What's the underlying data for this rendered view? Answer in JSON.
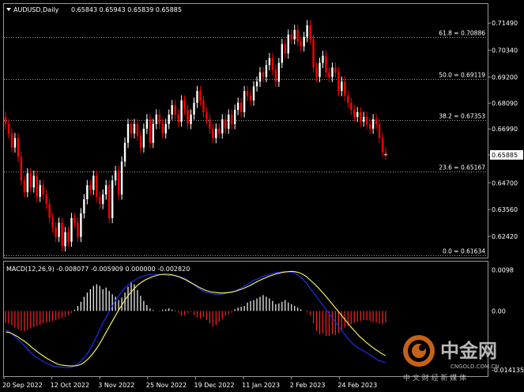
{
  "header": {
    "symbol": "AUDUSD,Daily",
    "ohlc": "0.65843 0.65943 0.65839 0.65885",
    "macd_label": "MACD(12,26,9) -0.008077 -0.005909 0.000000 -0.002820"
  },
  "colors": {
    "background": "#000000",
    "bull_candle": "#ffffff",
    "bear_candle": "#ff0000",
    "grid": "#9a9a9a",
    "macd_main": "#2030ff",
    "macd_signal": "#ffff66",
    "hist_pos": "#ffffff",
    "hist_neg": "#ff2020"
  },
  "chart_data": [
    {
      "type": "candlestick",
      "title": "AUDUSD,Daily",
      "price_axis_ticks": [
        "0.71490",
        "0.70340",
        "0.69200",
        "0.68090",
        "0.66990",
        "0.65885",
        "0.64700",
        "0.63560",
        "0.62420"
      ],
      "current_price": "0.65885",
      "ylim": [
        0.6155,
        0.718
      ],
      "time_axis_labels": [
        "20 Sep 2022",
        "12 Oct 2022",
        "3 Nov 2022",
        "25 Nov 2022",
        "19 Dec 2022",
        "11 Jan 2023",
        "2 Feb 2023",
        "24 Feb 2023"
      ],
      "fibonacci_levels": [
        {
          "label": "61.8 = 0.70886",
          "value": 0.70886
        },
        {
          "label": "50.0 = 0.69119",
          "value": 0.69119
        },
        {
          "label": "38.2 = 0.67353",
          "value": 0.67353
        },
        {
          "label": "23.6 = 0.65167",
          "value": 0.65167
        },
        {
          "label": "0.0 = 0.61634",
          "value": 0.61634
        }
      ],
      "closes": [
        0.672,
        0.668,
        0.662,
        0.666,
        0.658,
        0.648,
        0.643,
        0.651,
        0.645,
        0.65,
        0.641,
        0.646,
        0.642,
        0.638,
        0.632,
        0.628,
        0.624,
        0.63,
        0.62,
        0.626,
        0.622,
        0.632,
        0.63,
        0.624,
        0.634,
        0.64,
        0.646,
        0.644,
        0.65,
        0.641,
        0.638,
        0.642,
        0.646,
        0.632,
        0.648,
        0.652,
        0.642,
        0.656,
        0.664,
        0.672,
        0.668,
        0.672,
        0.667,
        0.662,
        0.67,
        0.674,
        0.664,
        0.672,
        0.676,
        0.672,
        0.668,
        0.672,
        0.676,
        0.68,
        0.676,
        0.673,
        0.682,
        0.678,
        0.672,
        0.676,
        0.681,
        0.686,
        0.682,
        0.677,
        0.674,
        0.67,
        0.666,
        0.67,
        0.668,
        0.674,
        0.67,
        0.676,
        0.672,
        0.678,
        0.681,
        0.677,
        0.686,
        0.684,
        0.682,
        0.688,
        0.69,
        0.694,
        0.692,
        0.697,
        0.7,
        0.695,
        0.69,
        0.698,
        0.706,
        0.702,
        0.71,
        0.708,
        0.712,
        0.707,
        0.705,
        0.709,
        0.714,
        0.708,
        0.696,
        0.692,
        0.698,
        0.701,
        0.694,
        0.692,
        0.696,
        0.694,
        0.686,
        0.69,
        0.684,
        0.681,
        0.678,
        0.675,
        0.677,
        0.673,
        0.675,
        0.672,
        0.67,
        0.674,
        0.672,
        0.666,
        0.66,
        0.6589
      ],
      "macd_axis_ticks": [
        "0.0098",
        "0.00",
        "-0.014135"
      ],
      "macd_ylim": [
        -0.0145,
        0.0105
      ],
      "macd_hist": [
        -0.0028,
        -0.003,
        -0.0034,
        -0.004,
        -0.0044,
        -0.0047,
        -0.0049,
        -0.0046,
        -0.0042,
        -0.0039,
        -0.0036,
        -0.0034,
        -0.0031,
        -0.0028,
        -0.0026,
        -0.0024,
        -0.0022,
        -0.002,
        -0.0017,
        -0.0014,
        -0.001,
        -0.0005,
        0.0003,
        0.0012,
        0.0022,
        0.0034,
        0.0044,
        0.0052,
        0.006,
        0.0064,
        0.006,
        0.0052,
        0.0056,
        0.0048,
        0.004,
        0.0034,
        0.0026,
        0.0032,
        0.0044,
        0.0058,
        0.007,
        0.0064,
        0.005,
        0.0036,
        0.0024,
        0.0014,
        0.0006,
        0.0002,
        0.0,
        -0.0002,
        0.0003,
        0.0004,
        0.0006,
        0.0003,
        0.0001,
        -0.0004,
        -0.0012,
        -0.001,
        -0.0005,
        -0.0002,
        -0.001,
        -0.0016,
        -0.0018,
        -0.0014,
        -0.0022,
        -0.003,
        -0.0038,
        -0.0034,
        -0.0026,
        -0.002,
        -0.0012,
        -0.0008,
        -0.0004,
        0.0004,
        0.0008,
        0.001,
        0.0012,
        0.002,
        0.0024,
        0.0026,
        0.003,
        0.0034,
        0.0038,
        0.0034,
        0.003,
        0.0024,
        0.0016,
        0.0018,
        0.0022,
        0.0026,
        0.002,
        0.0016,
        0.0012,
        0.0008,
        0.0004,
        0.0,
        -0.0004,
        -0.001,
        -0.003,
        -0.0048,
        -0.0056,
        -0.0054,
        -0.006,
        -0.006,
        -0.0056,
        -0.0058,
        -0.0052,
        -0.0046,
        -0.004,
        -0.0036,
        -0.0032,
        -0.0028,
        -0.0026,
        -0.0024,
        -0.0022,
        -0.0022,
        -0.0024,
        -0.0026,
        -0.0028,
        -0.003,
        -0.0032,
        -0.0028
      ],
      "macd_main": [
        -0.0045,
        -0.005,
        -0.0058,
        -0.0066,
        -0.0075,
        -0.0084,
        -0.0094,
        -0.0103,
        -0.011,
        -0.0116,
        -0.0121,
        -0.0126,
        -0.013,
        -0.0133,
        -0.0134,
        -0.0135,
        -0.0136,
        -0.0136,
        -0.0133,
        -0.0128,
        -0.012,
        -0.011,
        -0.0098,
        -0.0082,
        -0.0064,
        -0.0044,
        -0.0026,
        -0.001,
        0.0006,
        0.0022,
        0.0036,
        0.0048,
        0.0058,
        0.0066,
        0.0072,
        0.0078,
        0.0082,
        0.0085,
        0.0087,
        0.0088,
        0.0088,
        0.0087,
        0.0086,
        0.0085,
        0.0085,
        0.0084,
        0.0083,
        0.008,
        0.0076,
        0.007,
        0.0063,
        0.0056,
        0.005,
        0.0046,
        0.0043,
        0.0041,
        0.004,
        0.004,
        0.0041,
        0.0043,
        0.0045,
        0.0048,
        0.0052,
        0.0057,
        0.0062,
        0.0068,
        0.0073,
        0.0077,
        0.0081,
        0.0084,
        0.0087,
        0.009,
        0.0092,
        0.0093,
        0.0094,
        0.0094,
        0.0093,
        0.009,
        0.0084,
        0.0076,
        0.0066,
        0.0054,
        0.0042,
        0.003,
        0.0018,
        0.0006,
        -0.0006,
        -0.0018,
        -0.003,
        -0.0042,
        -0.0054,
        -0.0066,
        -0.0076,
        -0.0084,
        -0.009,
        -0.0095,
        -0.01,
        -0.0106,
        -0.0112,
        -0.0118,
        -0.0121,
        -0.0124
      ],
      "macd_signal": [
        -0.005,
        -0.0052,
        -0.0056,
        -0.0061,
        -0.0067,
        -0.0073,
        -0.008,
        -0.0088,
        -0.0095,
        -0.0102,
        -0.0108,
        -0.0114,
        -0.0119,
        -0.0124,
        -0.0128,
        -0.013,
        -0.0131,
        -0.0132,
        -0.0132,
        -0.0131,
        -0.0128,
        -0.0122,
        -0.0114,
        -0.0104,
        -0.0092,
        -0.0078,
        -0.0062,
        -0.0046,
        -0.003,
        -0.0014,
        0.0002,
        0.0016,
        0.003,
        0.0042,
        0.0052,
        0.0061,
        0.0068,
        0.0074,
        0.0078,
        0.0082,
        0.0085,
        0.0087,
        0.0088,
        0.0088,
        0.0087,
        0.0085,
        0.0082,
        0.0078,
        0.0074,
        0.0069,
        0.0064,
        0.0059,
        0.0054,
        0.005,
        0.0047,
        0.0045,
        0.0044,
        0.0043,
        0.0043,
        0.0044,
        0.0045,
        0.0047,
        0.005,
        0.0053,
        0.0057,
        0.0061,
        0.0066,
        0.0071,
        0.0075,
        0.0079,
        0.0083,
        0.0086,
        0.0089,
        0.0091,
        0.0093,
        0.0094,
        0.0095,
        0.0094,
        0.0092,
        0.0088,
        0.0082,
        0.0074,
        0.0066,
        0.0057,
        0.0047,
        0.0037,
        0.0026,
        0.0015,
        0.0004,
        -0.0007,
        -0.0018,
        -0.0029,
        -0.004,
        -0.005,
        -0.006,
        -0.0068,
        -0.0076,
        -0.0083,
        -0.009,
        -0.0096,
        -0.0102,
        -0.0107
      ]
    }
  ],
  "watermark": {
    "brand": "中金网",
    "domain": "CNGOLD.COM.CN",
    "tagline": "中 文 财 经 新 媒 体"
  }
}
